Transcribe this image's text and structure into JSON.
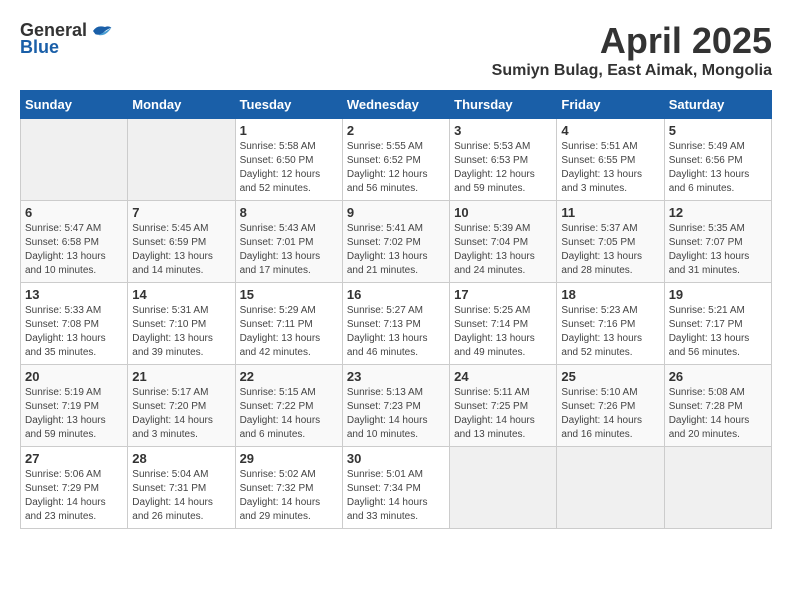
{
  "logo": {
    "general": "General",
    "blue": "Blue"
  },
  "header": {
    "title": "April 2025",
    "subtitle": "Sumiyn Bulag, East Aimak, Mongolia"
  },
  "days_of_week": [
    "Sunday",
    "Monday",
    "Tuesday",
    "Wednesday",
    "Thursday",
    "Friday",
    "Saturday"
  ],
  "weeks": [
    [
      {
        "day": "",
        "info": ""
      },
      {
        "day": "",
        "info": ""
      },
      {
        "day": "1",
        "info": "Sunrise: 5:58 AM\nSunset: 6:50 PM\nDaylight: 12 hours and 52 minutes."
      },
      {
        "day": "2",
        "info": "Sunrise: 5:55 AM\nSunset: 6:52 PM\nDaylight: 12 hours and 56 minutes."
      },
      {
        "day": "3",
        "info": "Sunrise: 5:53 AM\nSunset: 6:53 PM\nDaylight: 12 hours and 59 minutes."
      },
      {
        "day": "4",
        "info": "Sunrise: 5:51 AM\nSunset: 6:55 PM\nDaylight: 13 hours and 3 minutes."
      },
      {
        "day": "5",
        "info": "Sunrise: 5:49 AM\nSunset: 6:56 PM\nDaylight: 13 hours and 6 minutes."
      }
    ],
    [
      {
        "day": "6",
        "info": "Sunrise: 5:47 AM\nSunset: 6:58 PM\nDaylight: 13 hours and 10 minutes."
      },
      {
        "day": "7",
        "info": "Sunrise: 5:45 AM\nSunset: 6:59 PM\nDaylight: 13 hours and 14 minutes."
      },
      {
        "day": "8",
        "info": "Sunrise: 5:43 AM\nSunset: 7:01 PM\nDaylight: 13 hours and 17 minutes."
      },
      {
        "day": "9",
        "info": "Sunrise: 5:41 AM\nSunset: 7:02 PM\nDaylight: 13 hours and 21 minutes."
      },
      {
        "day": "10",
        "info": "Sunrise: 5:39 AM\nSunset: 7:04 PM\nDaylight: 13 hours and 24 minutes."
      },
      {
        "day": "11",
        "info": "Sunrise: 5:37 AM\nSunset: 7:05 PM\nDaylight: 13 hours and 28 minutes."
      },
      {
        "day": "12",
        "info": "Sunrise: 5:35 AM\nSunset: 7:07 PM\nDaylight: 13 hours and 31 minutes."
      }
    ],
    [
      {
        "day": "13",
        "info": "Sunrise: 5:33 AM\nSunset: 7:08 PM\nDaylight: 13 hours and 35 minutes."
      },
      {
        "day": "14",
        "info": "Sunrise: 5:31 AM\nSunset: 7:10 PM\nDaylight: 13 hours and 39 minutes."
      },
      {
        "day": "15",
        "info": "Sunrise: 5:29 AM\nSunset: 7:11 PM\nDaylight: 13 hours and 42 minutes."
      },
      {
        "day": "16",
        "info": "Sunrise: 5:27 AM\nSunset: 7:13 PM\nDaylight: 13 hours and 46 minutes."
      },
      {
        "day": "17",
        "info": "Sunrise: 5:25 AM\nSunset: 7:14 PM\nDaylight: 13 hours and 49 minutes."
      },
      {
        "day": "18",
        "info": "Sunrise: 5:23 AM\nSunset: 7:16 PM\nDaylight: 13 hours and 52 minutes."
      },
      {
        "day": "19",
        "info": "Sunrise: 5:21 AM\nSunset: 7:17 PM\nDaylight: 13 hours and 56 minutes."
      }
    ],
    [
      {
        "day": "20",
        "info": "Sunrise: 5:19 AM\nSunset: 7:19 PM\nDaylight: 13 hours and 59 minutes."
      },
      {
        "day": "21",
        "info": "Sunrise: 5:17 AM\nSunset: 7:20 PM\nDaylight: 14 hours and 3 minutes."
      },
      {
        "day": "22",
        "info": "Sunrise: 5:15 AM\nSunset: 7:22 PM\nDaylight: 14 hours and 6 minutes."
      },
      {
        "day": "23",
        "info": "Sunrise: 5:13 AM\nSunset: 7:23 PM\nDaylight: 14 hours and 10 minutes."
      },
      {
        "day": "24",
        "info": "Sunrise: 5:11 AM\nSunset: 7:25 PM\nDaylight: 14 hours and 13 minutes."
      },
      {
        "day": "25",
        "info": "Sunrise: 5:10 AM\nSunset: 7:26 PM\nDaylight: 14 hours and 16 minutes."
      },
      {
        "day": "26",
        "info": "Sunrise: 5:08 AM\nSunset: 7:28 PM\nDaylight: 14 hours and 20 minutes."
      }
    ],
    [
      {
        "day": "27",
        "info": "Sunrise: 5:06 AM\nSunset: 7:29 PM\nDaylight: 14 hours and 23 minutes."
      },
      {
        "day": "28",
        "info": "Sunrise: 5:04 AM\nSunset: 7:31 PM\nDaylight: 14 hours and 26 minutes."
      },
      {
        "day": "29",
        "info": "Sunrise: 5:02 AM\nSunset: 7:32 PM\nDaylight: 14 hours and 29 minutes."
      },
      {
        "day": "30",
        "info": "Sunrise: 5:01 AM\nSunset: 7:34 PM\nDaylight: 14 hours and 33 minutes."
      },
      {
        "day": "",
        "info": ""
      },
      {
        "day": "",
        "info": ""
      },
      {
        "day": "",
        "info": ""
      }
    ]
  ]
}
